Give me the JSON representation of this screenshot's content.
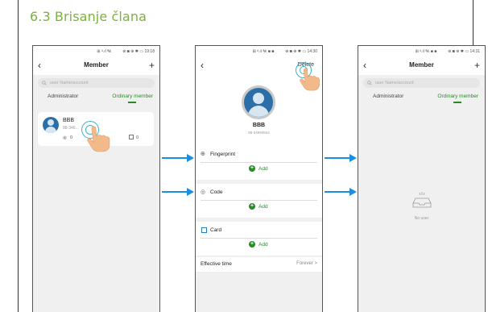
{
  "document": {
    "section_title": "6.3 Brisanje člana"
  },
  "phone1": {
    "status_left": "⊞ ᵈ.ıl ℀",
    "status_right": "⊛ ◙ ⊕ ✱ ▭ 19:18",
    "back_icon": "chevron-left-icon",
    "title": "Member",
    "plus": "+",
    "search_placeholder": "user Name/account",
    "tab_admin": "Administrator",
    "tab_ordinary": "Ordinary member",
    "member": {
      "name": "BBB",
      "id": "88-346...",
      "fingerprint_count": "0",
      "card_count": "0"
    }
  },
  "phone2": {
    "status_left": "⊞ ᵈ.ıl ℀ ■ ■",
    "status_right": "⊛ ◙ ⊕ ✱ ▭ 14:30",
    "title": "Delete",
    "name": "BBB",
    "id": "88-34993504",
    "sections": [
      {
        "label": "Fingerprint",
        "add": "Add"
      },
      {
        "label": "Code",
        "add": "Add"
      },
      {
        "label": "Card",
        "add": "Add"
      }
    ],
    "effective_label": "Effective time",
    "effective_value": "Forever >"
  },
  "phone3": {
    "status_left": "⊞ ᵈ.ıl ℀ ■ ■",
    "status_right": "⊛ ◙ ⊕ ✱ ▭ 14:31",
    "title": "Member",
    "plus": "+",
    "search_placeholder": "user Name/account",
    "tab_admin": "Administrator",
    "tab_ordinary": "Ordinary member",
    "empty_label": "No user"
  },
  "colors": {
    "title_green": "#7ab23c",
    "accent_green": "#2a8a2a",
    "arrow_blue": "#1a8fe0",
    "ripple_teal": "#3bb3c6"
  }
}
